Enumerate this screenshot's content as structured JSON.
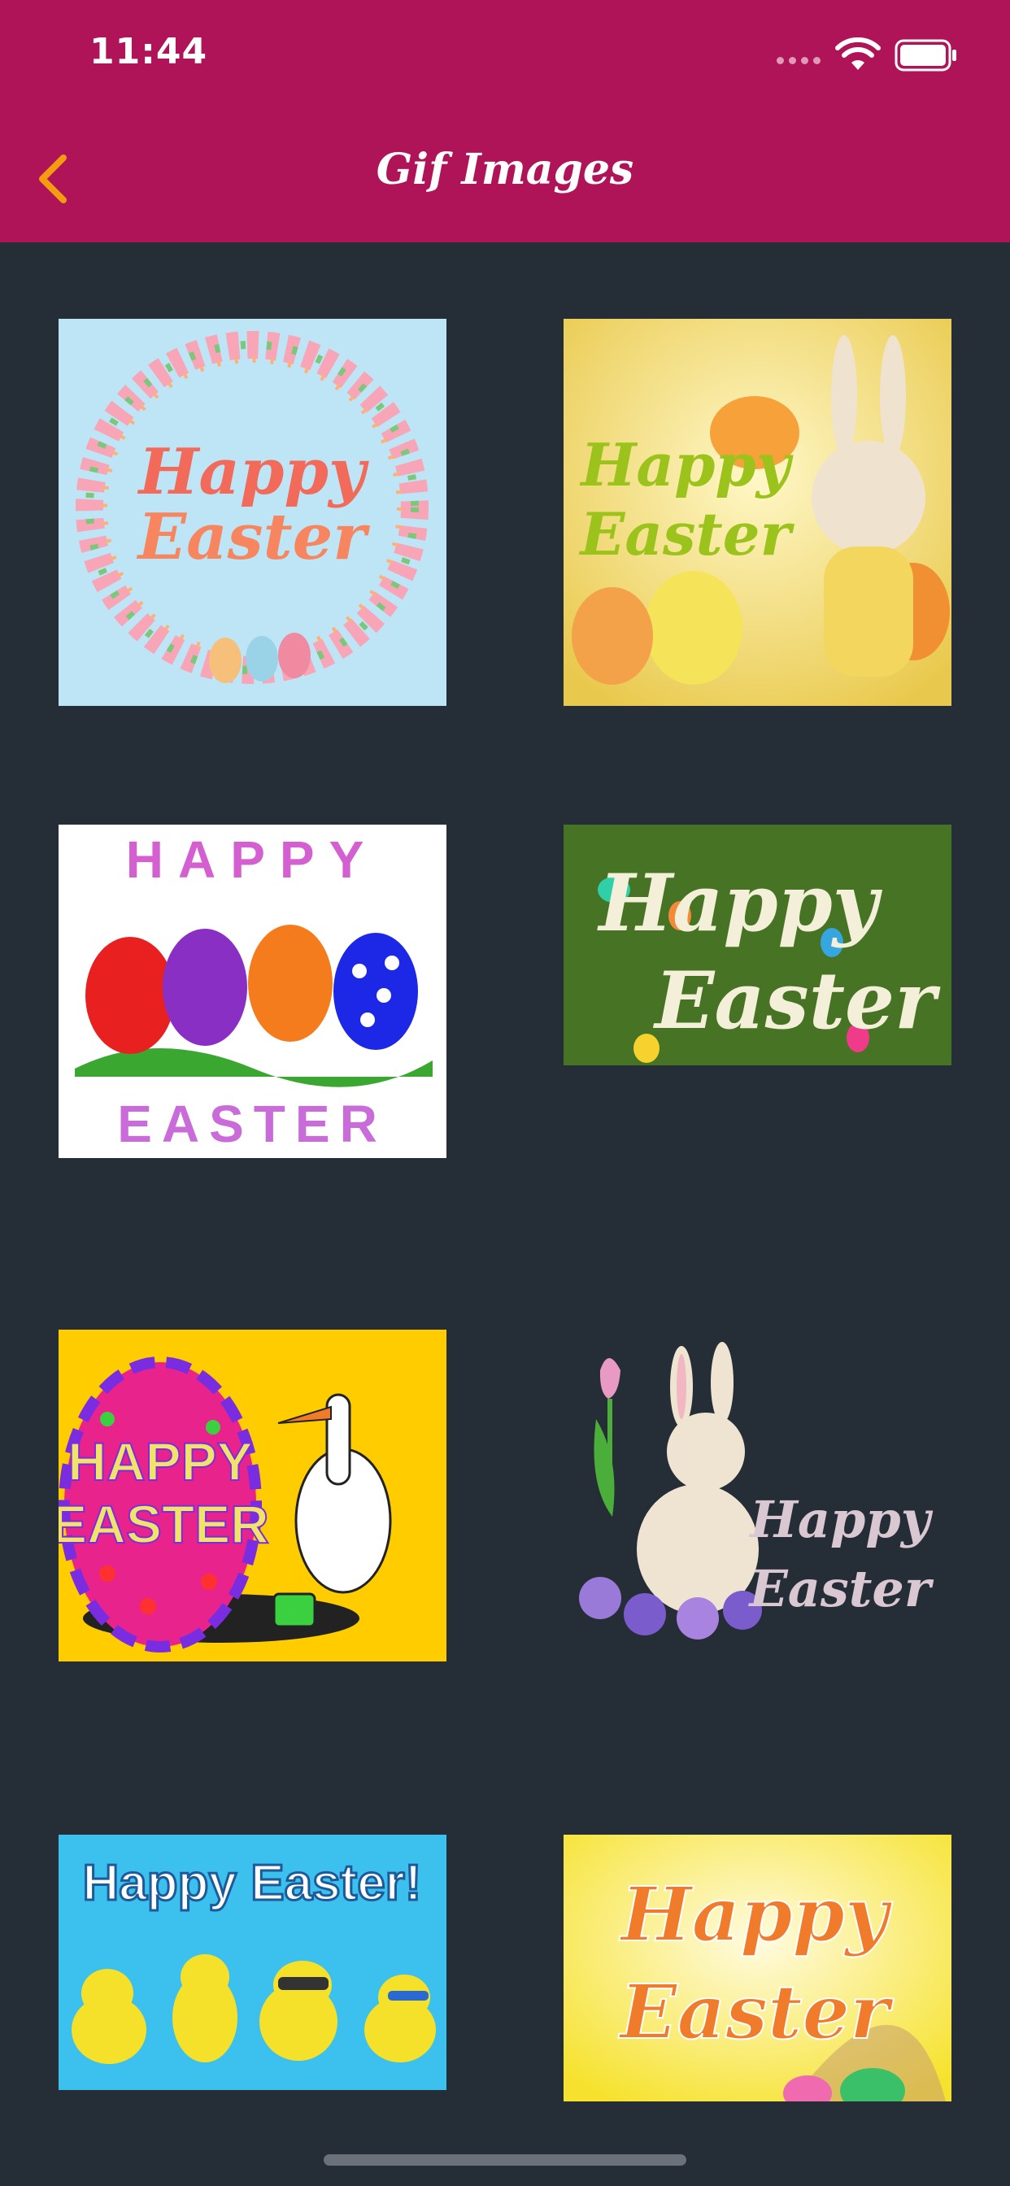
{
  "status": {
    "time": "11:44"
  },
  "nav": {
    "title": "Gif Images"
  },
  "gifs": [
    {
      "text": "Happy Easter",
      "bg": "#bde5f5",
      "ink": "#f26a5a"
    },
    {
      "text": "Happy Easter",
      "bg": "#f7e89a",
      "ink": "#9bc31b"
    },
    {
      "line1": "HAPPY",
      "line2": "EASTER",
      "bg": "#ffffff"
    },
    {
      "text": "Happy Easter",
      "bg": "#4c7a28",
      "ink": "#f4efd8"
    },
    {
      "line1": "HAPPY",
      "line2": "EASTER",
      "bg": "#ffcc00",
      "ink": "#f1e26a"
    },
    {
      "text": "Happy Easter",
      "bg": "#252e37",
      "ink": "#d9c7d2"
    },
    {
      "text": "Happy Easter!",
      "bg": "#3cc0ee",
      "ink": "#ffffff"
    },
    {
      "text": "Happy Easter",
      "bg": "#fff15a",
      "ink": "#f07b2a"
    }
  ]
}
